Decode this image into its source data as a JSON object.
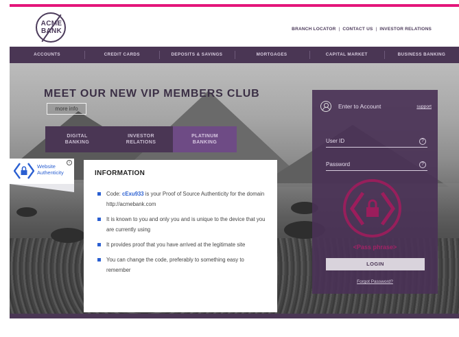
{
  "header": {
    "logo_text": "ACME BANK",
    "top_links": [
      "BRANCH LOCATOR",
      "CONTACT US",
      "INVESTOR RELATIONS"
    ]
  },
  "nav": {
    "items": [
      "ACCOUNTS",
      "CREDIT CARDS",
      "DEPOSITS & SAVINGS",
      "MORTGAGES",
      "CAPITAL MARKET",
      "BUSINESS BANKING"
    ]
  },
  "hero": {
    "title": "MEET OUR NEW VIP MEMBERS CLUB",
    "more_info": "more info",
    "tabs": [
      {
        "line1": "DIGITAL",
        "line2": "BANKING"
      },
      {
        "line1": "INVESTOR",
        "line2": "RELATIONS"
      },
      {
        "line1": "PLATINUM",
        "line2": "BANKING"
      }
    ]
  },
  "badge": {
    "line1": "Website",
    "line2": "Authenticity",
    "info_glyph": "i"
  },
  "info": {
    "title": "INFORMATION",
    "code_prefix": "Code: ",
    "code": "cExu933",
    "item1_rest": " is your Proof of Source Authenticity for the domain http://acmebank.com",
    "item2": "It is known to you and only you and is unique to the device that you are currently using",
    "item3": "It provides proof that you have arrived at the legitimate site",
    "item4": "You can change the code, preferably to something easy to remember"
  },
  "login": {
    "enter_label": "Enter to Account",
    "support": "support",
    "user_id_label": "User ID",
    "password_label": "Password",
    "help_glyph": "?",
    "pass_phrase": "<Pass phrase>",
    "login_button": "LOGIN",
    "forgot": "Forgot Password?"
  },
  "colors": {
    "brand_pink": "#e4157a",
    "brand_purple": "#4a3654",
    "link_blue": "#2a5fd1"
  }
}
